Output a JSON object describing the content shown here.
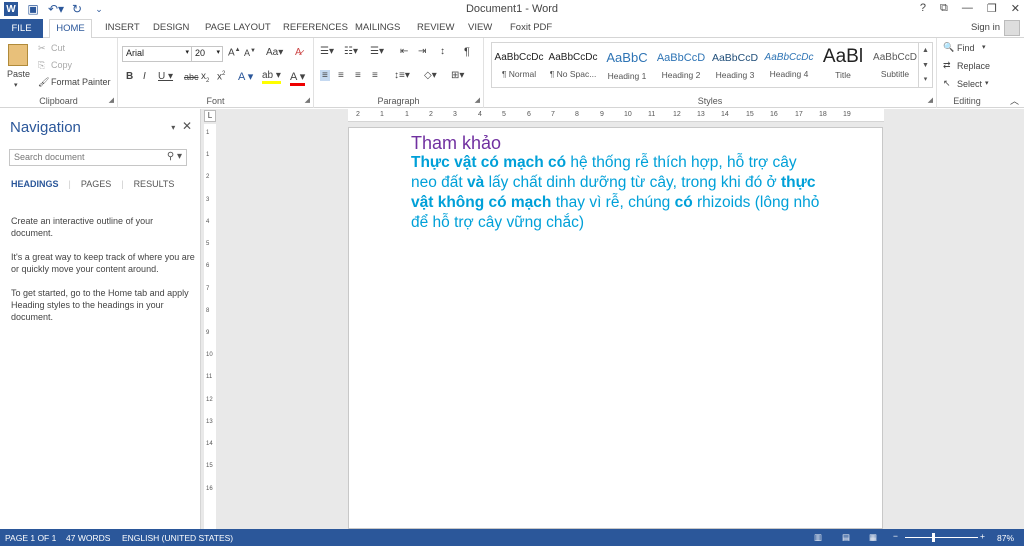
{
  "window": {
    "title": "Document1 - Word",
    "help": "?",
    "controls": [
      "⧉",
      "—",
      "❐",
      "✕"
    ]
  },
  "tabs": {
    "file": "FILE",
    "home": "HOME",
    "insert": "INSERT",
    "design": "DESIGN",
    "page_layout": "PAGE LAYOUT",
    "references": "REFERENCES",
    "mailings": "MAILINGS",
    "review": "REVIEW",
    "view": "VIEW",
    "foxit": "Foxit PDF",
    "signin": "Sign in"
  },
  "clipboard": {
    "paste": "Paste",
    "cut": "Cut",
    "copy": "Copy",
    "format_painter": "Format Painter",
    "label": "Clipboard"
  },
  "font": {
    "name": "Arial",
    "size": "20",
    "label": "Font"
  },
  "paragraph": {
    "label": "Paragraph"
  },
  "styles": {
    "label": "Styles",
    "items": [
      {
        "preview": "AaBbCcDc",
        "name": "¶ Normal"
      },
      {
        "preview": "AaBbCcDc",
        "name": "¶ No Spac..."
      },
      {
        "preview": "AaBbC",
        "name": "Heading 1"
      },
      {
        "preview": "AaBbCcD",
        "name": "Heading 2"
      },
      {
        "preview": "AaBbCcD",
        "name": "Heading 3"
      },
      {
        "preview": "AaBbCcDc",
        "name": "Heading 4"
      },
      {
        "preview": "AaBl",
        "name": "Title"
      },
      {
        "preview": "AaBbCcD",
        "name": "Subtitle"
      }
    ]
  },
  "editing": {
    "find": "Find",
    "replace": "Replace",
    "select": "Select",
    "label": "Editing"
  },
  "nav": {
    "title": "Navigation",
    "search_placeholder": "Search document",
    "tabs": [
      "HEADINGS",
      "PAGES",
      "RESULTS"
    ],
    "p1": "Create an interactive outline of your document.",
    "p2": "It's a great way to keep track of where you are or quickly move your content around.",
    "p3": "To get started, go to the Home tab and apply Heading styles to the headings in your document."
  },
  "ruler": {
    "h": [
      "2",
      "1",
      "1",
      "2",
      "3",
      "4",
      "5",
      "6",
      "7",
      "8",
      "9",
      "10",
      "11",
      "12",
      "13",
      "14",
      "15",
      "16",
      "17",
      "18",
      "19"
    ],
    "v": [
      "1",
      "1",
      "2",
      "3",
      "4",
      "5",
      "6",
      "7",
      "8",
      "9",
      "10",
      "11",
      "12",
      "13",
      "14",
      "15",
      "16"
    ]
  },
  "document": {
    "heading": "Tham khảo",
    "l1a": "Thực vật có mạch có",
    "l1b": " hệ thống rễ thích hợp, hỗ trợ cây neo đất ",
    "l1c": "và",
    "l1d": " lấy chất dinh dưỡng từ cây, trong khi đó ở ",
    "l1e": "thực vật không có mạch",
    "l1f": " thay vì rễ, chúng ",
    "l1g": "có",
    "l1h": " rhizoids (lông nhỏ để hỗ trợ cây vững chắc)"
  },
  "status": {
    "page": "PAGE 1 OF 1",
    "words": "47 WORDS",
    "lang": "ENGLISH (UNITED STATES)",
    "zoom": "87%"
  },
  "colors": {
    "accent": "#2b579a",
    "heading": "#7030a0",
    "body": "#00a0d8"
  }
}
